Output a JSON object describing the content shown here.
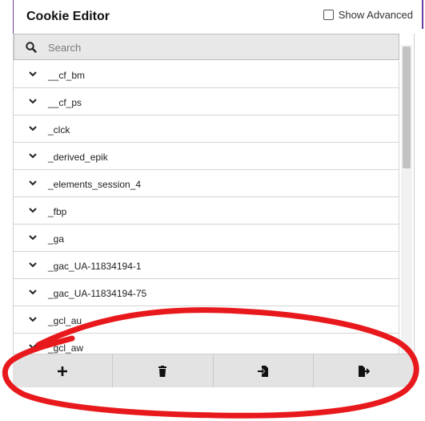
{
  "header": {
    "title": "Cookie Editor",
    "show_advanced_label": "Show Advanced",
    "show_advanced_checked": false
  },
  "search": {
    "placeholder": "Search",
    "icon": "search-icon"
  },
  "cookies": [
    {
      "name": "__cf_bm"
    },
    {
      "name": "__cf_ps"
    },
    {
      "name": "_clck"
    },
    {
      "name": "_derived_epik"
    },
    {
      "name": "_elements_session_4"
    },
    {
      "name": "_fbp"
    },
    {
      "name": "_ga"
    },
    {
      "name": "_gac_UA-11834194-1"
    },
    {
      "name": "_gac_UA-11834194-75"
    },
    {
      "name": "_gcl_au"
    },
    {
      "name": "_gcl_aw"
    }
  ],
  "toolbar": {
    "buttons": [
      {
        "name": "add",
        "icon": "plus-icon"
      },
      {
        "name": "delete-all",
        "icon": "trash-icon"
      },
      {
        "name": "import",
        "icon": "import-icon"
      },
      {
        "name": "export",
        "icon": "export-icon"
      }
    ]
  },
  "colors": {
    "frame_accent": "#6b3fa0",
    "annotation": "#e8191c",
    "toolbar_bg": "#e3e3e3",
    "search_bg": "#e8e8e8"
  }
}
